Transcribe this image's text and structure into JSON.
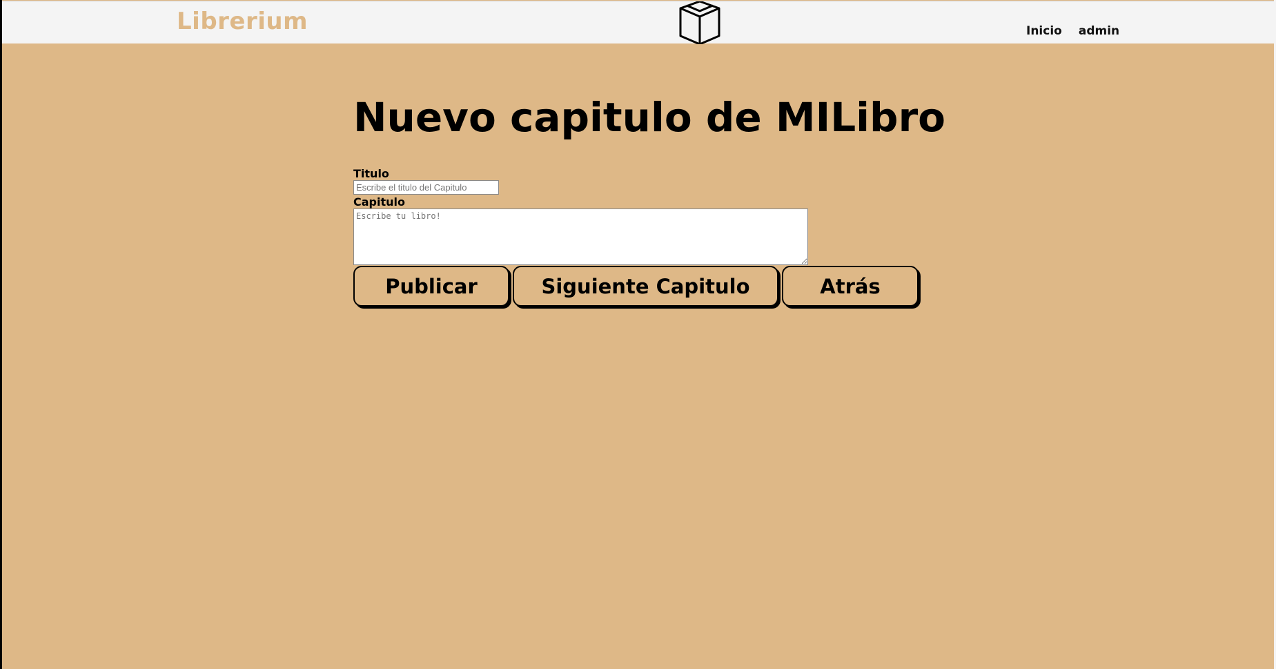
{
  "navbar": {
    "brand": "Librerium",
    "logo_icon": "open-book-icon",
    "links": [
      "Inicio",
      "admin"
    ]
  },
  "heading": "Nuevo capitulo de MILibro",
  "form": {
    "title_label": "Titulo",
    "title_placeholder": "Escribe el titulo del Capitulo",
    "title_value": "",
    "chapter_label": "Capitulo",
    "chapter_placeholder": "Escribe tu libro!",
    "chapter_value": ""
  },
  "buttons": {
    "publish": "Publicar",
    "next": "Siguiente Capitulo",
    "back": "Atrás"
  },
  "colors": {
    "background": "#deb887",
    "navbar": "#f4f4f4",
    "brand": "#deb887",
    "text": "#000000"
  }
}
